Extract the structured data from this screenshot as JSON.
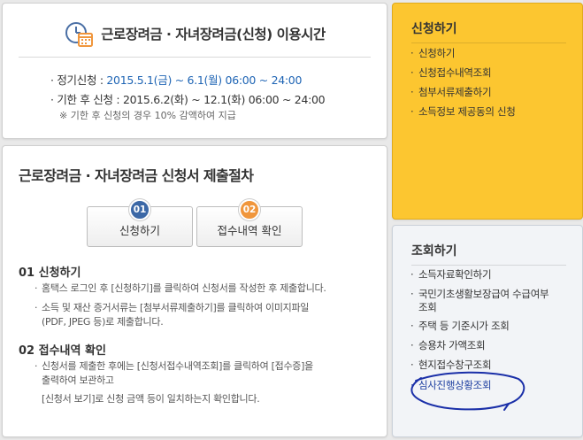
{
  "hours": {
    "title": "근로장려금 · 자녀장려금(신청) 이용시간",
    "regular_label": "· 정기신청 : ",
    "regular_value": "2015.5.1(금) ~ 6.1(월) 06:00 ~ 24:00",
    "late_label": "· 기한 후 신청 : ",
    "late_value": "2015.6.2(화) ~ 12.1(화) 06:00 ~ 24:00",
    "note": "※ 기한 후 신청의 경우 10% 감액하여 지급"
  },
  "procedure": {
    "title": "근로장려금 · 자녀장려금 신청서 제출절차",
    "step1": {
      "num": "01",
      "label": "신청하기"
    },
    "step2": {
      "num": "02",
      "label": "접수내역 확인"
    },
    "sec1_title": "01 신청하기",
    "sec1_lines": [
      "홈택스 로그인 후 [신청하기]를 클릭하여 신청서를 작성한 후 제출합니다.",
      "소득 및 재산 증거서류는 [첨부서류제출하기]를 클릭하여 이미지파일",
      "(PDF, JPEG 등)로 제출합니다."
    ],
    "sec2_title": "02 접수내역 확인",
    "sec2_lines": [
      "신청서를 제출한 후에는 [신청서접수내역조회]를 클릭하여 [접수증]을",
      "출력하여 보관하고",
      "[신청서 보기]로 신청 금액 등이 일치하는지 확인합니다."
    ]
  },
  "apply": {
    "title": "신청하기",
    "links": [
      "신청하기",
      "신청접수내역조회",
      "첨부서류제출하기",
      "소득정보 제공동의 신청"
    ]
  },
  "inquiry": {
    "title": "조회하기",
    "links": [
      "소득자료확인하기",
      "국민기초생활보장급여 수급여부",
      "조회",
      "주택 등 기준시가 조회",
      "승용차 가액조회",
      "현지접수창구조회",
      "심사진행상황조회"
    ]
  },
  "colors": {
    "accent_blue": "#1e64b4",
    "step1_circle": "#3c68a6",
    "step2_circle": "#f0963c",
    "apply_panel": "#fcc630",
    "annotation_ink": "#1a2fa8"
  }
}
